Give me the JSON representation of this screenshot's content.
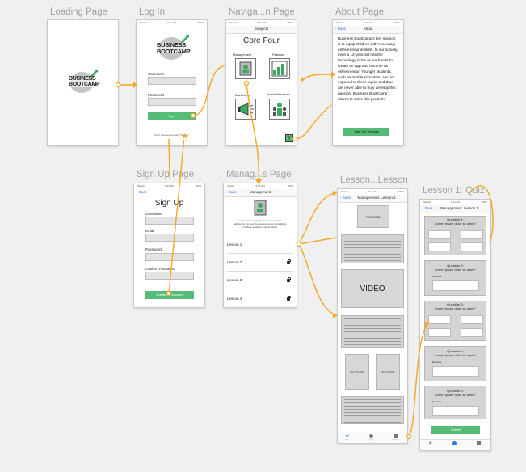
{
  "artboards": {
    "loading": {
      "label": "Loading Page"
    },
    "login": {
      "label": "Log In"
    },
    "navigation": {
      "label": "Naviga...n Page"
    },
    "about": {
      "label": "About Page"
    },
    "signup": {
      "label": "Sign Up Page"
    },
    "manage": {
      "label": "Manag...s Page"
    },
    "lesson": {
      "label": "Lesson...Lesson"
    },
    "quiz": {
      "label": "Lesson 1: Quiz"
    }
  },
  "status_bar": {
    "carrier": "Sketch",
    "time": "9:41 AM",
    "battery": "100%"
  },
  "logo": {
    "line1": "BUSINESS",
    "line2": "BOOTCAMP"
  },
  "login": {
    "username_label": "Username",
    "password_label": "Password",
    "login_button": "Log In",
    "signup_link": "Don't have an account? Sign up"
  },
  "navigation": {
    "nav_title": "Subjects",
    "heading": "Core Four",
    "subjects": [
      {
        "label": "Management"
      },
      {
        "label": "Finance"
      },
      {
        "label": "Marketing"
      },
      {
        "label": "Human Resources"
      }
    ],
    "help_label": "?"
  },
  "about": {
    "back": "Back",
    "nav_title": "About",
    "body": "Business BootCamp's key mission is to equip children with necessary entrepreneurial skills. In our society, even a 12-year-old has the technology in his or her hands to create an app and become an entrepreneur. Younger students, such as middle schoolers, are not exposed to these topics and thus are never able to truly develop this passion. Business BootCamp strives to solve this problem.",
    "visit_button": "Visit Our Website"
  },
  "signup": {
    "back": "Back",
    "heading": "Sign Up",
    "fields": [
      {
        "label": "Username"
      },
      {
        "label": "Email"
      },
      {
        "label": "Password"
      },
      {
        "label": "Confirm Password"
      }
    ],
    "create_button": "Create an Account"
  },
  "manage": {
    "back": "Back",
    "nav_title": "Management",
    "intro": "Lorem ipsum dolor sit amet, consectetur adipiscing elit, sed do eiusmod tempor incididunt ut labore et dolore magna aliqua.",
    "lessons": [
      {
        "label": "Lesson 1",
        "locked": false
      },
      {
        "label": "Lesson 2",
        "locked": true
      },
      {
        "label": "Lesson 3",
        "locked": true
      },
      {
        "label": "Lesson 4",
        "locked": true
      }
    ]
  },
  "lesson": {
    "back": "Back",
    "nav_title": "Management: Lesson 1",
    "picture_label": "PICTURE",
    "video_label": "VIDEO",
    "tabs": [
      "Lesson",
      "Quiz",
      "More"
    ]
  },
  "quiz": {
    "back": "Back",
    "nav_title": "Management: Lesson 1",
    "questions": [
      {
        "title": "Question 1:",
        "prompt": "Lorem ipsum dolor sit amet?",
        "kind": "grid"
      },
      {
        "title": "Question 2:",
        "prompt": "Lorem ipsum dolor sit amet?",
        "kind": "response",
        "response_label": "Response"
      },
      {
        "title": "Question 3:",
        "prompt": "Lorem ipsum dolor sit amet?",
        "kind": "grid"
      },
      {
        "title": "Question 4:",
        "prompt": "Lorem ipsum dolor sit amet?",
        "kind": "response",
        "response_label": "Response"
      },
      {
        "title": "Question 5:",
        "prompt": "Lorem ipsum dolor sit amet?",
        "kind": "response",
        "response_label": "Response"
      }
    ],
    "submit_button": "Submit"
  },
  "colors": {
    "accent_green": "#55bb77",
    "flow_orange": "#f5a623",
    "link_blue": "#2a77f2"
  }
}
